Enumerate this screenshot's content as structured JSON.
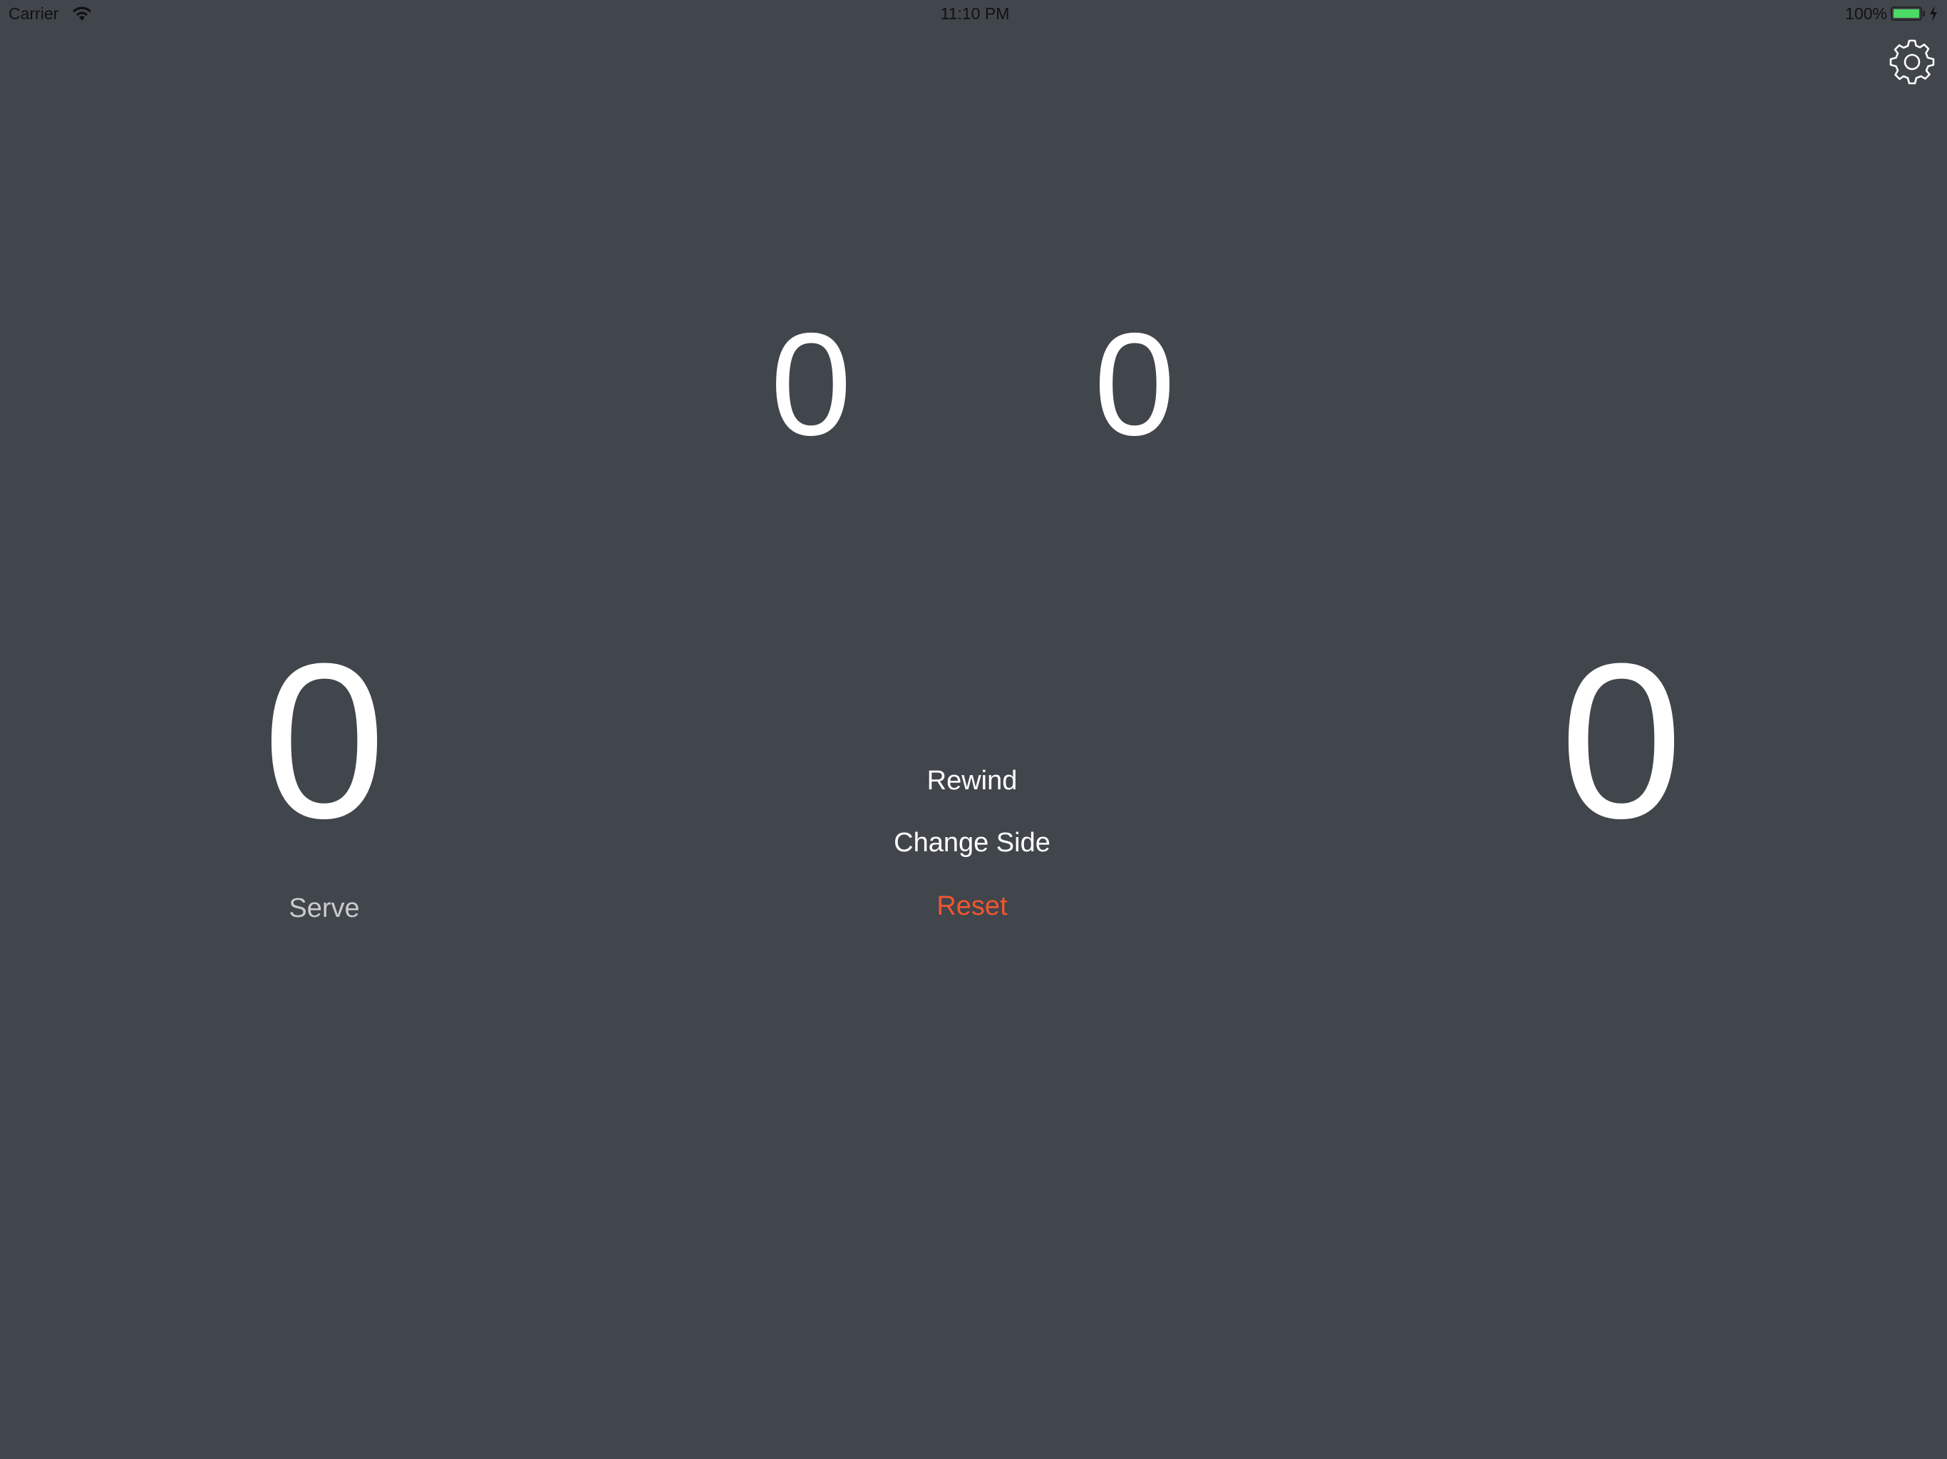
{
  "status_bar": {
    "carrier": "Carrier",
    "wifi_icon": "wifi-icon",
    "time": "11:10 PM",
    "battery_percent": "100%",
    "battery_level": 1.0,
    "battery_color": "#4cd964",
    "charging_icon": "bolt-icon"
  },
  "toolbar": {
    "settings_icon": "gear-icon"
  },
  "scoreboard": {
    "left_sets": "0",
    "right_sets": "0",
    "left_points": "0",
    "right_points": "0",
    "serve_label": "Serve"
  },
  "controls": {
    "rewind": "Rewind",
    "change_side": "Change Side",
    "reset": "Reset",
    "reset_color": "#f0562e"
  }
}
